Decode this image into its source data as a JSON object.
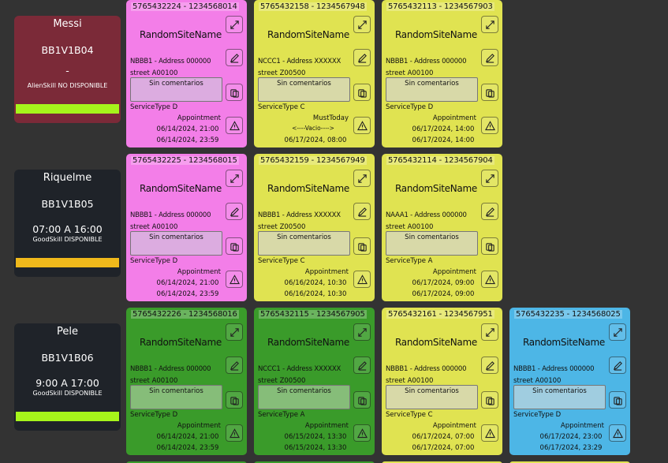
{
  "colors": {
    "pink": "#f37ee8",
    "yellow": "#e0e351",
    "green": "#3a9b2a",
    "blue": "#4db6e6",
    "tech_red": "#7b2a38",
    "tech_dark": "#1f2329",
    "bar_lime": "#a6f51b",
    "bar_orange": "#f0b91b"
  },
  "icons": [
    "expand-icon",
    "edit-icon",
    "copy-icon",
    "warning-icon"
  ],
  "technicians": [
    {
      "name": "Messi",
      "code": "BB1V1B04",
      "hours": "-",
      "skill": "AlienSkill NO DISPONIBLE",
      "cards": [
        {
          "id": "5765432224 - 1234568014",
          "site": "RandomSiteName",
          "addr": "NBBB1 - Address 000000",
          "street": "street A00100",
          "comment": "Sin comentarios",
          "service": "ServiceType D",
          "flag": "Appointment",
          "vacio": "",
          "t1": "06/14/2024, 21:00",
          "t2": "06/14/2024, 23:59"
        },
        {
          "id": "5765432158 - 1234567948",
          "site": "RandomSiteName",
          "addr": "NCCC1 - Address XXXXXX",
          "street": "street Z00500",
          "comment": "Sin comentarios",
          "service": "ServiceType C",
          "flag": "MustToday",
          "vacio": "<----Vacio---->",
          "t1": "06/17/2024, 08:00",
          "t2": ""
        },
        {
          "id": "5765432113 - 1234567903",
          "site": "RandomSiteName",
          "addr": "NBBB1 - Address 000000",
          "street": "street A00100",
          "comment": "Sin comentarios",
          "service": "ServiceType D",
          "flag": "Appointment",
          "vacio": "",
          "t1": "06/17/2024, 14:00",
          "t2": "06/17/2024, 14:00"
        }
      ]
    },
    {
      "name": "Riquelme",
      "code": "BB1V1B05",
      "hours": "07:00 A 16:00",
      "skill": "GoodSkill DISPONIBLE",
      "cards": [
        {
          "id": "5765432225 - 1234568015",
          "site": "RandomSiteName",
          "addr": "NBBB1 - Address 000000",
          "street": "street A00100",
          "comment": "Sin comentarios",
          "service": "ServiceType D",
          "flag": "Appointment",
          "vacio": "",
          "t1": "06/14/2024, 21:00",
          "t2": "06/14/2024, 23:59"
        },
        {
          "id": "5765432159 - 1234567949",
          "site": "RandomSiteName",
          "addr": "NBBB1 - Address XXXXXX",
          "street": "street Z00500",
          "comment": "Sin comentarios",
          "service": "ServiceType C",
          "flag": "Appointment",
          "vacio": "",
          "t1": "06/16/2024, 10:30",
          "t2": "06/16/2024, 10:30"
        },
        {
          "id": "5765432114 - 1234567904",
          "site": "RandomSiteName",
          "addr": "NAAA1 - Address 000000",
          "street": "street A00100",
          "comment": "Sin comentarios",
          "service": "ServiceType A",
          "flag": "Appointment",
          "vacio": "",
          "t1": "06/17/2024, 09:00",
          "t2": "06/17/2024, 09:00"
        }
      ]
    },
    {
      "name": "Pele",
      "code": "BB1V1B06",
      "hours": "9:00 A 17:00",
      "skill": "GoodSkill DISPONIBLE",
      "cards": [
        {
          "id": "5765432226 - 1234568016",
          "site": "RandomSiteName",
          "addr": "NBBB1 - Address 000000",
          "street": "street A00100",
          "comment": "Sin comentarios",
          "service": "ServiceType D",
          "flag": "Appointment",
          "vacio": "",
          "t1": "06/14/2024, 21:00",
          "t2": "06/14/2024, 23:59"
        },
        {
          "id": "5765432115 - 1234567905",
          "site": "RandomSiteName",
          "addr": "NCCC1 - Address XXXXXX",
          "street": "street Z00500",
          "comment": "Sin comentarios",
          "service": "ServiceType A",
          "flag": "Appointment",
          "vacio": "",
          "t1": "06/15/2024, 13:30",
          "t2": "06/15/2024, 13:30"
        },
        {
          "id": "5765432161 - 1234567951",
          "site": "RandomSiteName",
          "addr": "NBBB1 - Address 000000",
          "street": "street A00100",
          "comment": "Sin comentarios",
          "service": "ServiceType C",
          "flag": "Appointment",
          "vacio": "",
          "t1": "06/17/2024, 07:00",
          "t2": "06/17/2024, 07:00"
        },
        {
          "id": "5765432235 - 1234568025",
          "site": "RandomSiteName",
          "addr": "NBBB1 - Address 000000",
          "street": "street A00100",
          "comment": "Sin comentarios",
          "service": "ServiceType D",
          "flag": "Appointment",
          "vacio": "",
          "t1": "06/17/2024, 23:00",
          "t2": "06/17/2024, 23:29"
        }
      ]
    }
  ]
}
